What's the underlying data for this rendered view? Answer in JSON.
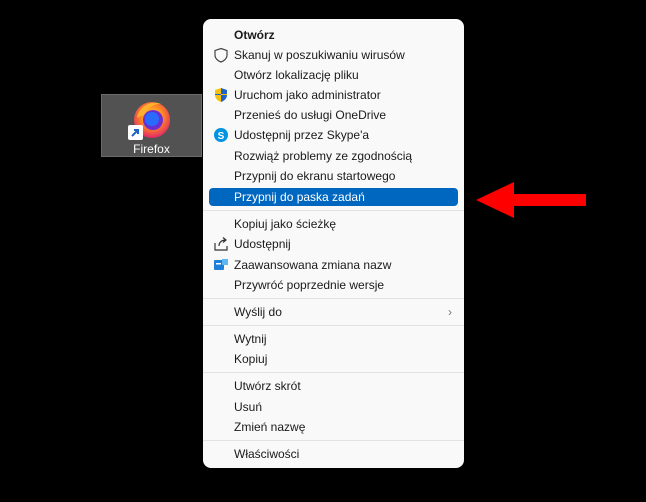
{
  "desktop_icon": {
    "label": "Firefox",
    "icon": "firefox-icon",
    "overlay": "shortcut-arrow-icon"
  },
  "menu": {
    "items": [
      {
        "label": "Otwórz",
        "bold": true
      },
      {
        "label": "Skanuj w poszukiwaniu wirusów",
        "icon": "shield-icon"
      },
      {
        "label": "Otwórz lokalizację pliku"
      },
      {
        "label": "Uruchom jako administrator",
        "icon": "uac-shield-icon"
      },
      {
        "label": "Przenieś do usługi OneDrive"
      },
      {
        "label": "Udostępnij przez Skype'a",
        "icon": "skype-icon"
      },
      {
        "label": "Rozwiąż problemy ze zgodnością"
      },
      {
        "label": "Przypnij do ekranu startowego"
      },
      {
        "label": "Przypnij do paska zadań",
        "highlighted": true
      },
      {
        "label": "Kopiuj jako ścieżkę"
      },
      {
        "label": "Udostępnij",
        "icon": "share-icon"
      },
      {
        "label": "Zaawansowana zmiana nazw",
        "icon": "rename-icon"
      },
      {
        "label": "Przywróć poprzednie wersje"
      },
      {
        "label": "Wyślij do",
        "submenu": true
      },
      {
        "label": "Wytnij"
      },
      {
        "label": "Kopiuj"
      },
      {
        "label": "Utwórz skrót"
      },
      {
        "label": "Usuń"
      },
      {
        "label": "Zmień nazwę"
      },
      {
        "label": "Właściwości"
      }
    ],
    "submenu_chevron": "›"
  },
  "colors": {
    "highlight": "#0067c0",
    "menu_bg": "#f9f9f9",
    "arrow": "#ff0000"
  }
}
